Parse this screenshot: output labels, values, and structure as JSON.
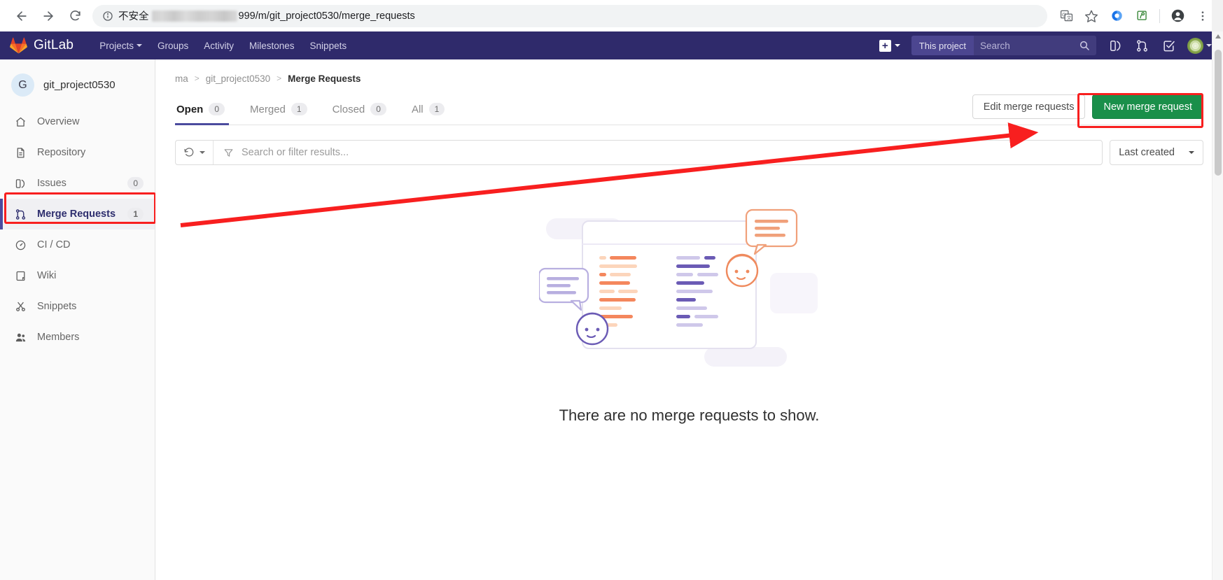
{
  "browser": {
    "back_icon": "back-arrow-icon",
    "forward_icon": "forward-arrow-icon",
    "reload_icon": "reload-icon",
    "security_label": "不安全",
    "url_visible": "999/m/git_project0530/merge_requests",
    "toolbar_icons": [
      "translate-icon",
      "bookmark-star-icon",
      "extension-blue-icon",
      "extension-green-icon",
      "profile-avatar-icon",
      "chrome-menu-icon"
    ]
  },
  "navbar": {
    "brand": "GitLab",
    "menu": [
      {
        "label": "Projects",
        "has_caret": true
      },
      {
        "label": "Groups",
        "has_caret": false
      },
      {
        "label": "Activity",
        "has_caret": false
      },
      {
        "label": "Milestones",
        "has_caret": false
      },
      {
        "label": "Snippets",
        "has_caret": false
      }
    ],
    "create_new_label": "+",
    "search_scope": "This project",
    "search_placeholder": "Search",
    "right_icons": [
      "issues-icon",
      "merge-requests-icon",
      "todos-icon"
    ],
    "avatar": "user-avatar"
  },
  "sidebar": {
    "project_initial": "G",
    "project_name": "git_project0530",
    "items": [
      {
        "label": "Overview",
        "icon": "home-icon",
        "count": ""
      },
      {
        "label": "Repository",
        "icon": "document-icon",
        "count": ""
      },
      {
        "label": "Issues",
        "icon": "issues-icon",
        "count": "0"
      },
      {
        "label": "Merge Requests",
        "icon": "merge-request-icon",
        "count": "1",
        "active": true
      },
      {
        "label": "CI / CD",
        "icon": "rocket-icon",
        "count": ""
      },
      {
        "label": "Wiki",
        "icon": "book-icon",
        "count": ""
      },
      {
        "label": "Snippets",
        "icon": "scissors-icon",
        "count": ""
      },
      {
        "label": "Members",
        "icon": "users-icon",
        "count": ""
      }
    ]
  },
  "breadcrumb": {
    "items": [
      "ma",
      "git_project0530",
      "Merge Requests"
    ],
    "separator": ">"
  },
  "tabs": [
    {
      "label": "Open",
      "count": "0",
      "active": true
    },
    {
      "label": "Merged",
      "count": "1",
      "active": false
    },
    {
      "label": "Closed",
      "count": "0",
      "active": false
    },
    {
      "label": "All",
      "count": "1",
      "active": false
    }
  ],
  "actions": {
    "edit_label": "Edit merge requests",
    "new_label": "New merge request",
    "new_button_color": "#1a8f4a"
  },
  "filter": {
    "recent_icon": "history-icon",
    "filter_icon": "funnel-icon",
    "placeholder": "Search or filter results...",
    "sort_label": "Last created"
  },
  "empty_state": {
    "message": "There are no merge requests to show.",
    "illustration": "merge-request-empty-illustration"
  },
  "annotations": {
    "highlight_color": "#f81f1f",
    "boxes": [
      "merge-requests-sidebar-item",
      "new-merge-request-button"
    ],
    "arrow": "pointer-arrow-to-new-merge-request"
  }
}
